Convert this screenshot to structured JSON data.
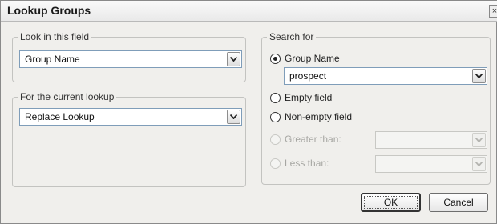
{
  "dialog": {
    "title": "Lookup Groups",
    "close_glyph": "×"
  },
  "look_in": {
    "legend": "Look in this field",
    "selected": "Group Name"
  },
  "current_lookup": {
    "legend": "For the current lookup",
    "selected": "Replace Lookup"
  },
  "search_for": {
    "legend": "Search for",
    "options": {
      "group_name": {
        "label": "Group Name",
        "checked": true,
        "enabled": true
      },
      "empty_field": {
        "label": "Empty field",
        "checked": false,
        "enabled": true
      },
      "non_empty_field": {
        "label": "Non-empty field",
        "checked": false,
        "enabled": true
      },
      "greater_than": {
        "label": "Greater than:",
        "checked": false,
        "enabled": false
      },
      "less_than": {
        "label": "Less than:",
        "checked": false,
        "enabled": false
      }
    },
    "group_name_value": "prospect"
  },
  "buttons": {
    "ok": "OK",
    "cancel": "Cancel"
  }
}
